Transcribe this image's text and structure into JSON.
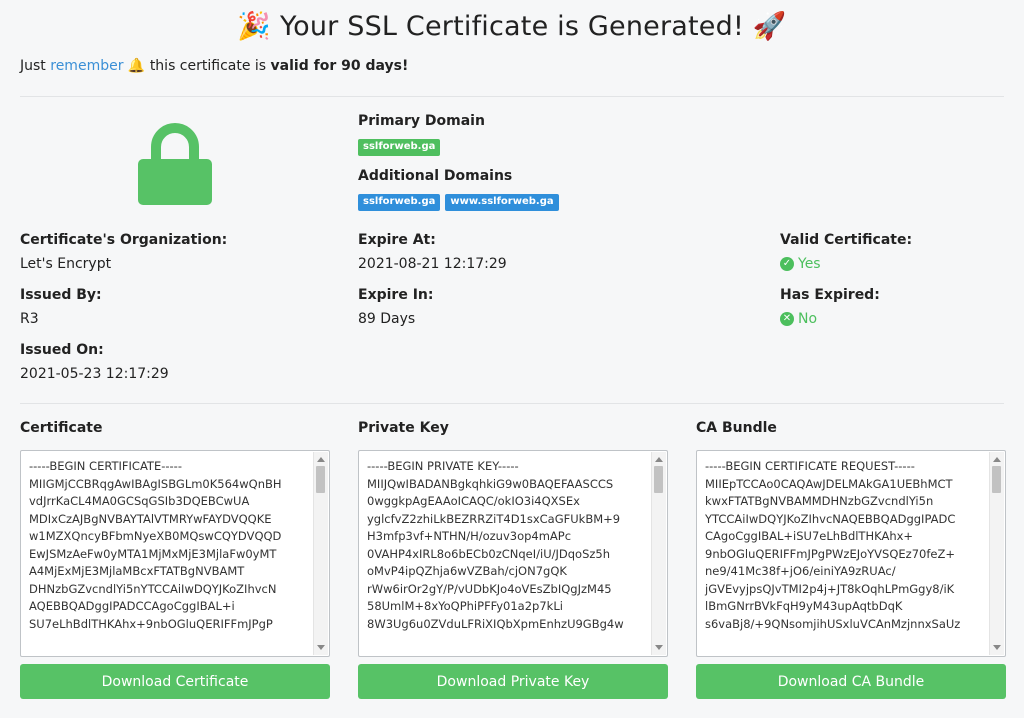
{
  "title": "🎉 Your SSL Certificate is Generated! 🚀",
  "notice": {
    "prefix": "Just",
    "link": "remember",
    "bell": "🔔",
    "middle": "this certificate is",
    "bold": "valid for 90 days!"
  },
  "domains": {
    "primary_label": "Primary Domain",
    "primary": [
      "sslforweb.ga"
    ],
    "additional_label": "Additional Domains",
    "additional": [
      "sslforweb.ga",
      "www.sslforweb.ga"
    ]
  },
  "details": {
    "org_label": "Certificate's Organization:",
    "org": "Let's Encrypt",
    "issued_by_label": "Issued By:",
    "issued_by": "R3",
    "issued_on_label": "Issued On:",
    "issued_on": "2021-05-23 12:17:29",
    "expire_at_label": "Expire At:",
    "expire_at": "2021-08-21 12:17:29",
    "expire_in_label": "Expire In:",
    "expire_in": "89 Days",
    "valid_label": "Valid Certificate:",
    "valid": "Yes",
    "valid_icon": "check-circle-icon",
    "expired_label": "Has Expired:",
    "expired": "No",
    "expired_icon": "x-circle-icon"
  },
  "colors": {
    "accent_green": "#57c266",
    "link_blue": "#3a8fd6",
    "badge_blue": "#2f8fdb"
  },
  "certificate": {
    "label": "Certificate",
    "text": "-----BEGIN CERTIFICATE-----\nMIIGMjCCBRqgAwIBAgISBGLm0K564wQnBH\nvdJrrKaCL4MA0GCSqGSIb3DQEBCwUA\nMDIxCzAJBgNVBAYTAlVTMRYwFAYDVQQKE\nw1MZXQncyBFbmNyeXB0MQswCQYDVQQD\nEwJSMzAeFw0yMTA1MjMxMjE3MjlaFw0yMT\nA4MjExMjE3MjlaMBcxFTATBgNVBAMT\nDHNzbGZvcndlYi5nYTCCAiIwDQYJKoZIhvcN\nAQEBBQADggIPADCCAgoCggIBAL+i\nSU7eLhBdlTHKAhx+9nbOGluQERIFFmJPgP",
    "button": "Download Certificate"
  },
  "private_key": {
    "label": "Private Key",
    "text": "-----BEGIN PRIVATE KEY-----\nMIIJQwIBADANBgkqhkiG9w0BAQEFAASCCS\n0wggkpAgEAAoICAQC/okIO3i4QXSEx\nyglcfvZ2zhiLkBEZRRZiT4D1sxCaGFUkBM+9\nH3mfp3vf+NTHN/H/ozuv3op4mAPc\n0VAHP4xIRL8o6bECb0zCNqeI/iU/JDqoSz5h\noMvP4ipQZhja6wVZBah/cjON7gQK\nrWw6irOr2gY/P/vUDbKJo4oVEsZbIQgJzM45\n58UmlM+8xYoQPhiPFFy01a2p7kLi\n8W3Ug6u0ZVduLFRiXIQbXpmEnhzU9GBg4w",
    "button": "Download Private Key"
  },
  "ca_bundle": {
    "label": "CA Bundle",
    "text": "-----BEGIN CERTIFICATE REQUEST-----\nMIIEpTCCAo0CAQAwJDELMAkGA1UEBhMCT\nkwxFTATBgNVBAMMDHNzbGZvcndlYi5n\nYTCCAiIwDQYJKoZIhvcNAQEBBQADggIPADC\nCAgoCggIBAL+iSU7eLhBdlTHKAhx+\n9nbOGluQERIFFmJPgPWzEJoYVSQEz70feZ+\nne9/41Mc38f+jO6/einiYA9zRUAc/\njGVEvyjpsQJvTMI2p4j+JT8kOqhLPmGgy8/iK\nlBmGNrrBVkFqH9yM43upAqtbDqK\ns6vaBj8/+9QNsomjihUSxluVCAnMzjnnxSaUz",
    "button": "Download CA Bundle"
  }
}
